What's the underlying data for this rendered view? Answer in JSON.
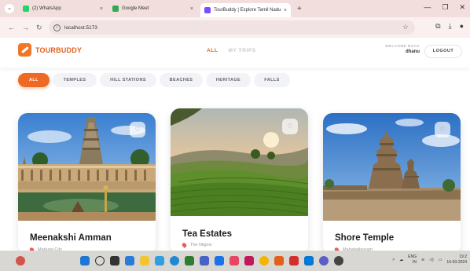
{
  "browser": {
    "menu_glyph": "⌄",
    "tabs": [
      {
        "title": "(2) WhatsApp",
        "color": "#25d366"
      },
      {
        "title": "Google Meet",
        "color": "#34a853"
      },
      {
        "title": "TourBuddy | Explore Tamil Nadu",
        "color": "#7c4dff"
      }
    ],
    "new_tab": "+",
    "url": "localhost:5173",
    "close_glyph": "×"
  },
  "app": {
    "logo": {
      "brand": "TOURBUDDY",
      "accent": "#ee6a24"
    },
    "nav": [
      {
        "label": "ALL",
        "active": true
      },
      {
        "label": "MY TRIPS",
        "active": false
      }
    ],
    "welcome_label": "WELCOME BACK",
    "username": "dhanu",
    "logout_label": "LOGOUT"
  },
  "filters": [
    {
      "label": "ALL",
      "active": true
    },
    {
      "label": "TEMPLES",
      "active": false
    },
    {
      "label": "HILL STATIONS",
      "active": false
    },
    {
      "label": "BEACHES",
      "active": false
    },
    {
      "label": "HERITAGE",
      "active": false
    },
    {
      "label": "FALLS",
      "active": false
    }
  ],
  "cards": [
    {
      "title": "Meenakshi Amman",
      "location": "Madurai City",
      "icon": "heart-icon"
    },
    {
      "title": "Tea Estates",
      "location": "The Nilgiris",
      "icon": "heart-icon"
    },
    {
      "title": "Shore Temple",
      "location": "Mahabalipuram",
      "icon": "heart-icon"
    }
  ],
  "taskbar": {
    "lang_top": "ENG",
    "lang_bottom": "IN",
    "time": "19:2",
    "date": "16-03-2024"
  }
}
